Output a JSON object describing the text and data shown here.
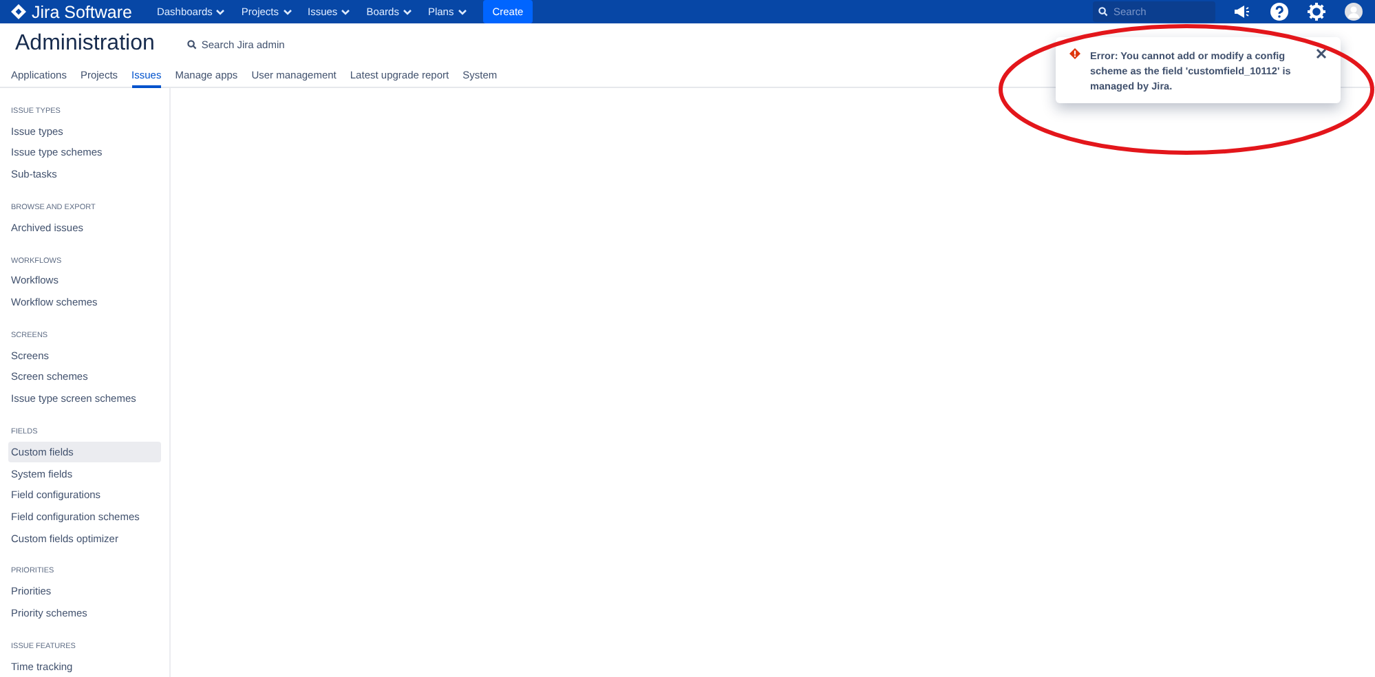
{
  "top_nav": {
    "product": "Jira Software",
    "menus": [
      {
        "label": "Dashboards"
      },
      {
        "label": "Projects"
      },
      {
        "label": "Issues"
      },
      {
        "label": "Boards"
      },
      {
        "label": "Plans"
      }
    ],
    "create": "Create",
    "search": {
      "placeholder": "Search"
    }
  },
  "header": {
    "title": "Administration",
    "search_link": "Search Jira admin"
  },
  "tabs": [
    {
      "label": "Applications",
      "selected": false
    },
    {
      "label": "Projects",
      "selected": false
    },
    {
      "label": "Issues",
      "selected": true
    },
    {
      "label": "Manage apps",
      "selected": false
    },
    {
      "label": "User management",
      "selected": false
    },
    {
      "label": "Latest upgrade report",
      "selected": false
    },
    {
      "label": "System",
      "selected": false
    }
  ],
  "sidebar": {
    "groups": [
      {
        "heading": "ISSUE TYPES",
        "items": [
          {
            "label": "Issue types",
            "selected": false
          },
          {
            "label": "Issue type schemes",
            "selected": false
          },
          {
            "label": "Sub-tasks",
            "selected": false
          }
        ]
      },
      {
        "heading": "BROWSE AND EXPORT",
        "items": [
          {
            "label": "Archived issues",
            "selected": false
          }
        ]
      },
      {
        "heading": "WORKFLOWS",
        "items": [
          {
            "label": "Workflows",
            "selected": false
          },
          {
            "label": "Workflow schemes",
            "selected": false
          }
        ]
      },
      {
        "heading": "SCREENS",
        "items": [
          {
            "label": "Screens",
            "selected": false
          },
          {
            "label": "Screen schemes",
            "selected": false
          },
          {
            "label": "Issue type screen schemes",
            "selected": false
          }
        ]
      },
      {
        "heading": "FIELDS",
        "items": [
          {
            "label": "Custom fields",
            "selected": true
          },
          {
            "label": "System fields",
            "selected": false
          },
          {
            "label": "Field configurations",
            "selected": false
          },
          {
            "label": "Field configuration schemes",
            "selected": false
          },
          {
            "label": "Custom fields optimizer",
            "selected": false
          }
        ]
      },
      {
        "heading": "PRIORITIES",
        "items": [
          {
            "label": "Priorities",
            "selected": false
          },
          {
            "label": "Priority schemes",
            "selected": false
          }
        ]
      },
      {
        "heading": "ISSUE FEATURES",
        "items": [
          {
            "label": "Time tracking",
            "selected": false
          }
        ]
      }
    ]
  },
  "error_flag": {
    "message": "Error: You cannot add or modify a config scheme as the field 'customfield_10112' is managed by Jira."
  }
}
